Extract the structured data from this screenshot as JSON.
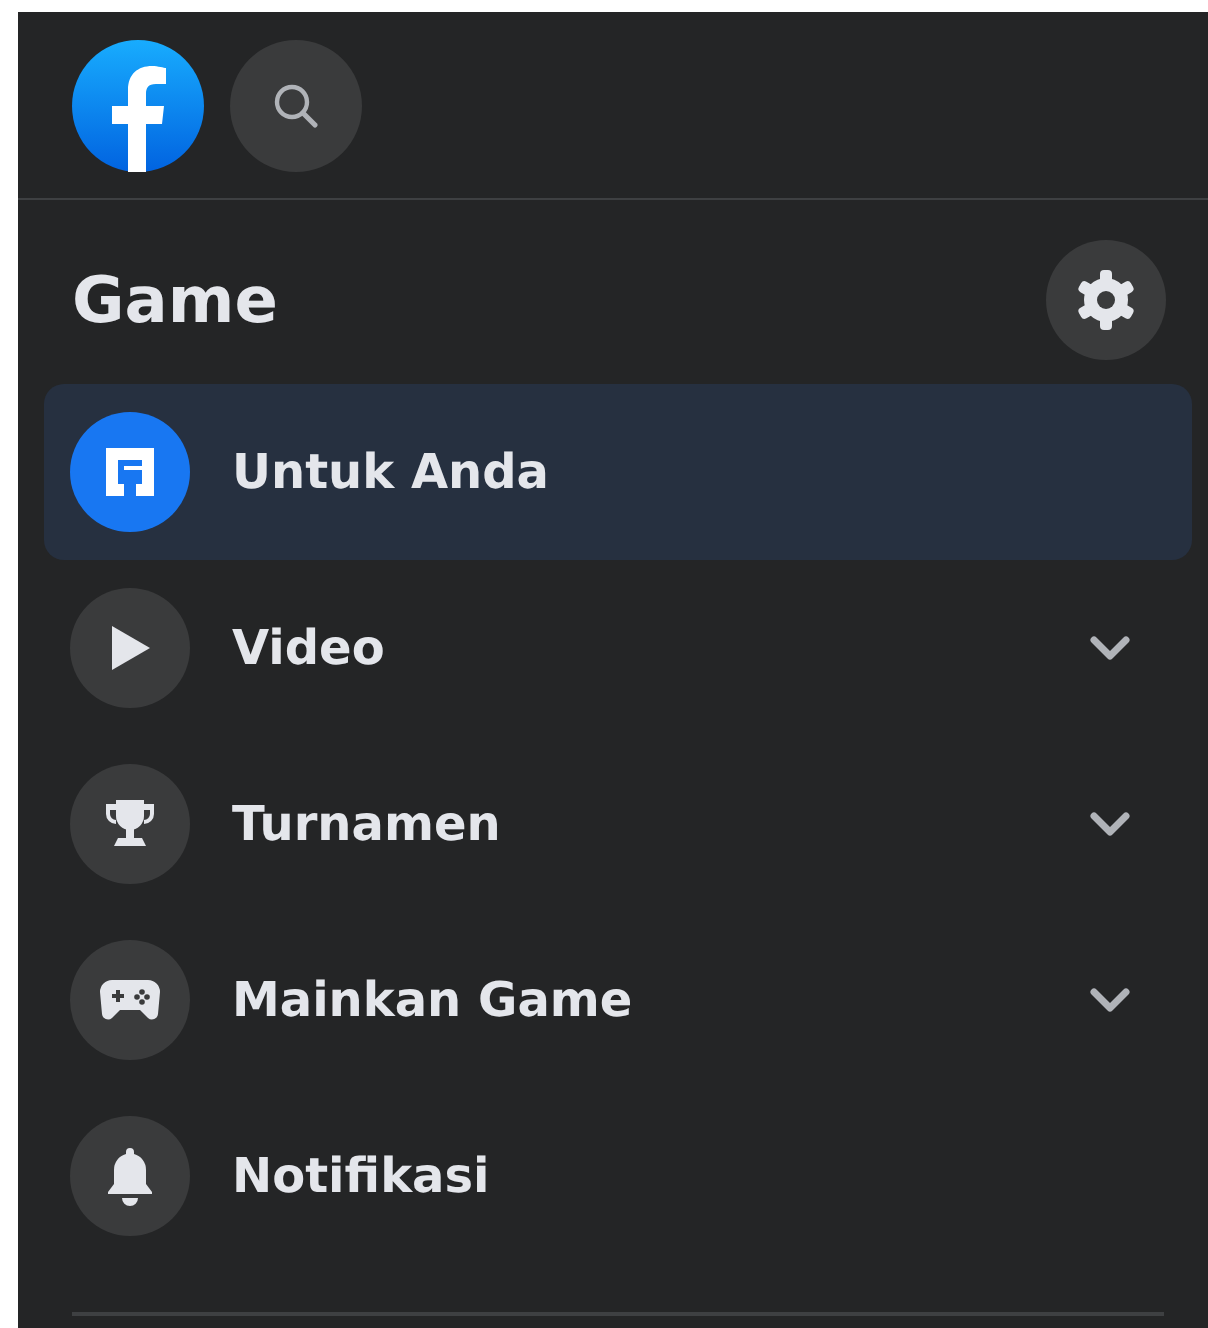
{
  "header": {
    "title": "Game"
  },
  "items": [
    {
      "label": "Untuk Anda",
      "selected": true,
      "expandable": false
    },
    {
      "label": "Video",
      "selected": false,
      "expandable": true
    },
    {
      "label": "Turnamen",
      "selected": false,
      "expandable": true
    },
    {
      "label": "Mainkan Game",
      "selected": false,
      "expandable": true
    },
    {
      "label": "Notifikasi",
      "selected": false,
      "expandable": false
    }
  ]
}
